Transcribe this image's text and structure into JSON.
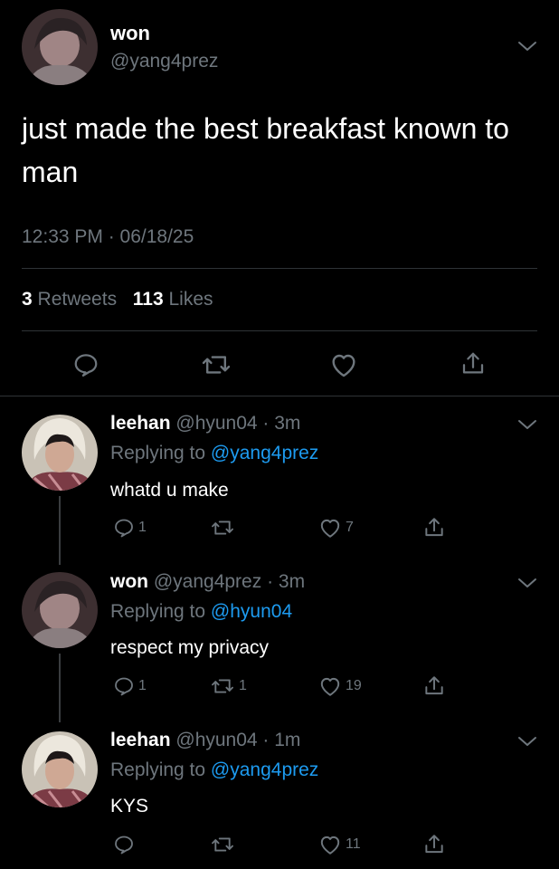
{
  "main_tweet": {
    "display_name": "won",
    "handle": "@yang4prez",
    "text": "just made the best breakfast known to man",
    "timestamp": "12:33 PM · 06/18/25",
    "retweets_count": "3",
    "retweets_label": "Retweets",
    "likes_count": "113",
    "likes_label": "Likes"
  },
  "replies": [
    {
      "display_name": "leehan",
      "handle_time": "@hyun04 · 3m",
      "replying_prefix": "Replying to",
      "replying_to": "@yang4prez",
      "text": "whatd u make",
      "replies_count": "1",
      "retweets_count": "",
      "likes_count": "7"
    },
    {
      "display_name": "won",
      "handle_time": "@yang4prez · 3m",
      "replying_prefix": "Replying to",
      "replying_to": "@hyun04",
      "text": "respect my privacy",
      "replies_count": "1",
      "retweets_count": "1",
      "likes_count": "19"
    },
    {
      "display_name": "leehan",
      "handle_time": "@hyun04 · 1m",
      "replying_prefix": "Replying to",
      "replying_to": "@yang4prez",
      "text": "KYS",
      "replies_count": "",
      "retweets_count": "",
      "likes_count": "11"
    }
  ],
  "colors": {
    "background": "#000000",
    "text": "#ffffff",
    "muted": "#6e767d",
    "link": "#1d9bf0",
    "divider": "#2f3336"
  },
  "icons": [
    "chevron-down-icon",
    "reply-icon",
    "retweet-icon",
    "like-icon",
    "share-icon"
  ]
}
